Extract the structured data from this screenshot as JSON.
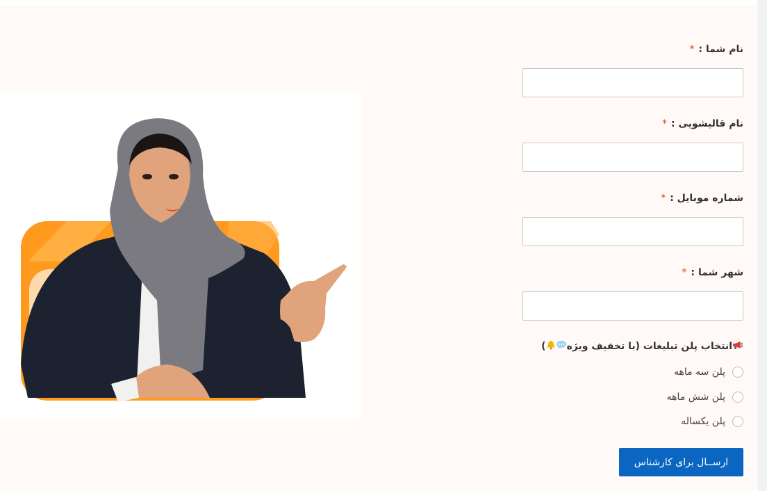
{
  "form": {
    "fields": [
      {
        "label": "نام شما :",
        "required_mark": "*",
        "value": ""
      },
      {
        "label": "نام قالیشویی :",
        "required_mark": "*",
        "value": ""
      },
      {
        "label": "شماره موبایل :",
        "required_mark": "*",
        "value": ""
      },
      {
        "label": "شهر شما :",
        "required_mark": "*",
        "value": ""
      }
    ],
    "plan_section": {
      "title": "انتخاب پلن تبلیغات (با تخفیف ویژه",
      "closing": ")",
      "icons": [
        "megaphone-icon",
        "speech-bubble-icon",
        "bell-icon"
      ],
      "options": [
        "پلن سه ماهه",
        "پلن شش ماهه",
        "پلن یکساله"
      ],
      "selected": null
    },
    "submit_label": "ارســال برای کارشناس"
  },
  "colors": {
    "accent": "#0b66c2",
    "required": "#e2401c",
    "background": "#fffaf7",
    "illustration_orange": "#ff9a1f"
  }
}
